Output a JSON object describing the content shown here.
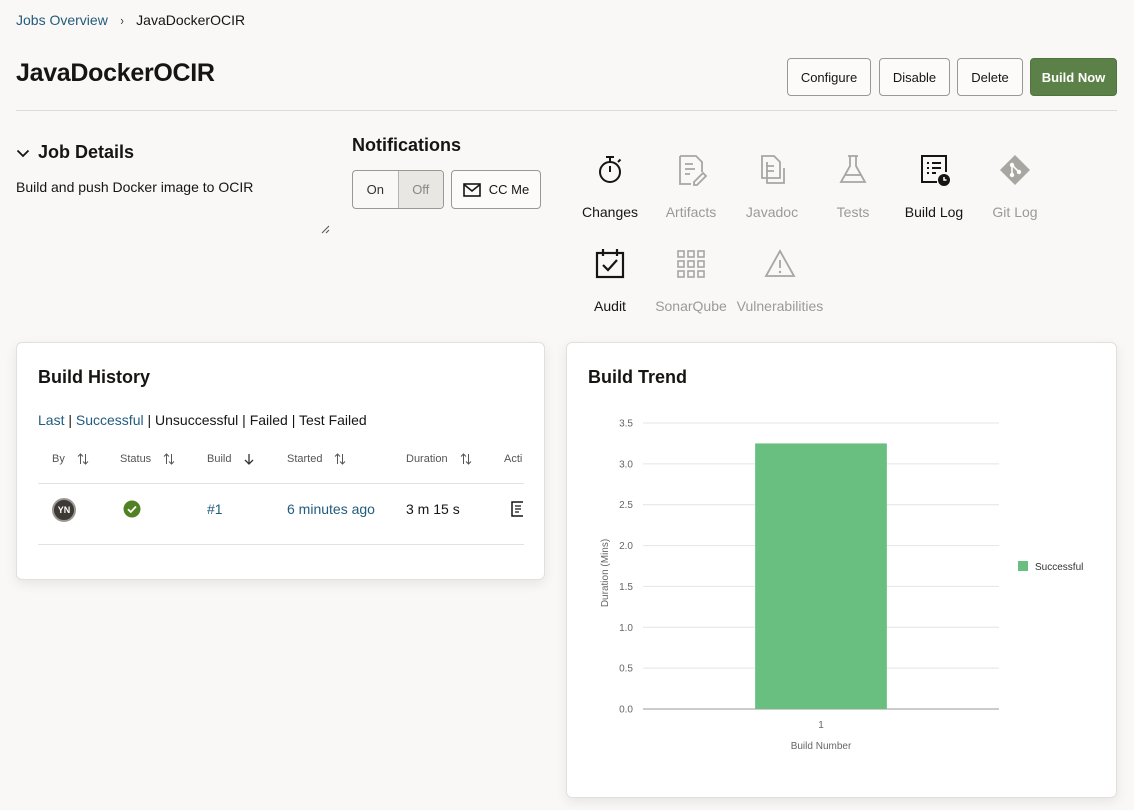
{
  "breadcrumb": {
    "parent": "Jobs Overview",
    "separator": "›",
    "current": "JavaDockerOCIR"
  },
  "page": {
    "title": "JavaDockerOCIR"
  },
  "actions": {
    "configure": "Configure",
    "disable": "Disable",
    "delete": "Delete",
    "build_now": "Build Now"
  },
  "job_details": {
    "heading": "Job Details",
    "description": "Build and push Docker image to OCIR"
  },
  "notifications": {
    "heading": "Notifications",
    "on": "On",
    "off": "Off",
    "selected": "Off",
    "cc_me": "CC Me"
  },
  "tools": [
    {
      "label": "Changes",
      "icon": "stopwatch-icon",
      "enabled": true
    },
    {
      "label": "Artifacts",
      "icon": "artifacts-icon",
      "enabled": false
    },
    {
      "label": "Javadoc",
      "icon": "javadoc-icon",
      "enabled": false
    },
    {
      "label": "Tests",
      "icon": "flask-icon",
      "enabled": false
    },
    {
      "label": "Build Log",
      "icon": "build-log-icon",
      "enabled": true
    },
    {
      "label": "Git Log",
      "icon": "git-icon",
      "enabled": false
    },
    {
      "label": "Audit",
      "icon": "audit-calendar-icon",
      "enabled": true
    },
    {
      "label": "SonarQube",
      "icon": "grid-icon",
      "enabled": false
    },
    {
      "label": "Vulnerabilities",
      "icon": "warning-icon",
      "enabled": false
    }
  ],
  "build_history": {
    "title": "Build History",
    "filters": {
      "last": "Last",
      "successful": "Successful",
      "unsuccessful": "Unsuccessful",
      "failed": "Failed",
      "test_failed": "Test Failed",
      "separator": "|"
    },
    "columns": {
      "by": "By",
      "status": "Status",
      "build": "Build",
      "started": "Started",
      "duration": "Duration",
      "actions": "Acti"
    },
    "rows": [
      {
        "by": "YN",
        "status": "success",
        "build": "#1",
        "started": "6 minutes ago",
        "duration": "3 m 15 s"
      }
    ]
  },
  "build_trend": {
    "title": "Build Trend",
    "chart_data": {
      "type": "bar",
      "categories": [
        "1"
      ],
      "series": [
        {
          "name": "Successful",
          "values": [
            3.25
          ]
        }
      ],
      "xlabel": "Build Number",
      "ylabel": "Duration (Mins)",
      "ylim": [
        0,
        3.5
      ],
      "yticks": [
        "0.0",
        "0.5",
        "1.0",
        "1.5",
        "2.0",
        "2.5",
        "3.0",
        "3.5"
      ],
      "grid": true,
      "legend": "right",
      "color": "#68bf7f"
    }
  },
  "colors": {
    "accent": "#5c8148",
    "link": "#225c7d",
    "success": "#508223"
  }
}
